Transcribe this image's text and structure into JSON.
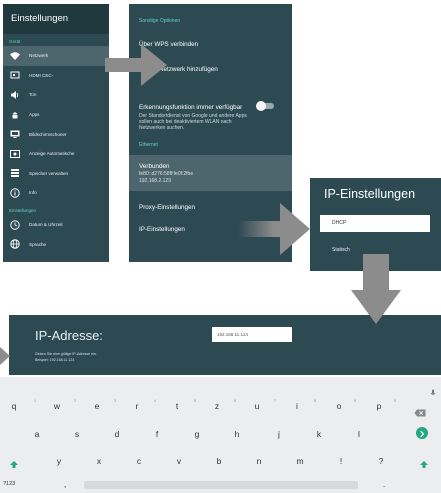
{
  "settings_panel": {
    "title": "Einstellungen",
    "section_device": "Gerät",
    "items": [
      {
        "label": "Netzwerk",
        "icon": "wifi-icon"
      },
      {
        "label": "HDMI CEC-",
        "icon": "hdmi-icon"
      },
      {
        "label": "Ton",
        "icon": "speaker-icon"
      },
      {
        "label": "Apps",
        "icon": "android-icon"
      },
      {
        "label": "Bildschirmschoner",
        "icon": "screensaver-icon"
      },
      {
        "label": "Anzeige Automatische",
        "icon": "display-icon"
      },
      {
        "label": "Speicher verwalten",
        "icon": "storage-icon"
      },
      {
        "label": "Info",
        "icon": "info-icon"
      }
    ],
    "section_settings": "Einstellungen",
    "items2": [
      {
        "label": "Datum & Uhrzeit",
        "icon": "clock-icon"
      },
      {
        "label": "Sprache",
        "icon": "globe-icon"
      }
    ]
  },
  "network_panel": {
    "section_other": "Sonstige Optionen",
    "wps": "Über WPS verbinden",
    "add_network": "Neues Netzwerk hinzufügen",
    "scan_title": "Erkennungsfunktion immer verfügbar",
    "scan_desc": "Der Standortdienst von Google und andere Apps sollen auch bei deaktiviertem WLAN nach Netzwerken suchen.",
    "section_ethernet": "Ethernet",
    "connected_title": "Verbunden",
    "connected_ipv6": "fe80::d276:58ff:fe0f:2fbe",
    "connected_ipv4": "192.168.2.129",
    "proxy": "Proxy-Einstellungen",
    "ip_settings": "IP-Einstellungen"
  },
  "ip_panel": {
    "title": "IP-Einstellungen",
    "options": [
      "DHCP",
      "Statisch"
    ],
    "selected": "DHCP"
  },
  "ip_entry": {
    "title": "IP-Adresse:",
    "hint_line1": "Geben Sie eine gültige IP-Adresse ein.",
    "hint_line2": "Beispiel: 192.168.11.124",
    "value": "192.168.11.124"
  },
  "keyboard": {
    "row1": [
      "q",
      "w",
      "e",
      "r",
      "t",
      "z",
      "u",
      "i",
      "o",
      "p"
    ],
    "row1_nums": [
      "1",
      "2",
      "3",
      "4",
      "5",
      "6",
      "7",
      "8",
      "9",
      "0"
    ],
    "row2": [
      "a",
      "s",
      "d",
      "f",
      "g",
      "h",
      "j",
      "k",
      "l"
    ],
    "row3": [
      "y",
      "x",
      "c",
      "v",
      "b",
      "n",
      "m",
      "!",
      "?"
    ],
    "symbols_key": "?123",
    "comma_key": ",",
    "period_key": ".",
    "accent_color": "#1fa882"
  },
  "colors": {
    "panel_bg": "#2d4a52",
    "title_bg": "#1f393f",
    "selected_bg": "#4d666d",
    "section_text": "#5fd3c7",
    "arrow": "#8c8c8c"
  }
}
